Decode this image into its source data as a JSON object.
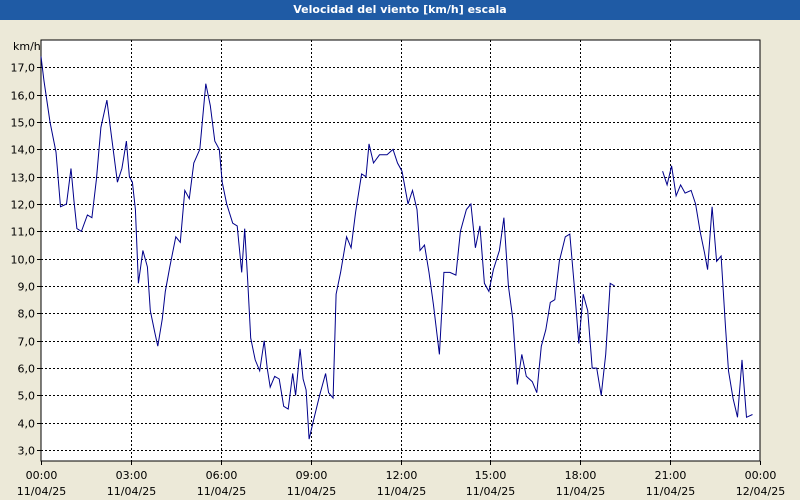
{
  "window": {
    "title": "Velocidad del viento [km/h] escala"
  },
  "chart_data": {
    "type": "line",
    "title": "Velocidad del viento [km/h] escala",
    "ylabel": "km/h",
    "ylim": [
      2.6,
      18.0
    ],
    "yticks": [
      3,
      4,
      5,
      6,
      7,
      8,
      9,
      10,
      11,
      12,
      13,
      14,
      15,
      16,
      17
    ],
    "ytick_labels": [
      "3,0",
      "4,0",
      "5,0",
      "6,0",
      "7,0",
      "8,0",
      "9,0",
      "10,0",
      "11,0",
      "12,0",
      "13,0",
      "14,0",
      "15,0",
      "16,0",
      "17,0"
    ],
    "xlim_hours": [
      0,
      24
    ],
    "xticks": [
      {
        "h": 0,
        "time": "00:00",
        "date": "11/04/25"
      },
      {
        "h": 3,
        "time": "03:00",
        "date": "11/04/25"
      },
      {
        "h": 6,
        "time": "06:00",
        "date": "11/04/25"
      },
      {
        "h": 9,
        "time": "09:00",
        "date": "11/04/25"
      },
      {
        "h": 12,
        "time": "12:00",
        "date": "11/04/25"
      },
      {
        "h": 15,
        "time": "15:00",
        "date": "11/04/25"
      },
      {
        "h": 18,
        "time": "18:00",
        "date": "11/04/25"
      },
      {
        "h": 21,
        "time": "21:00",
        "date": "11/04/25"
      },
      {
        "h": 24,
        "time": "00:00",
        "date": "12/04/25"
      }
    ],
    "grid": true,
    "colors": {
      "line": "#00008B",
      "grid": "#000000",
      "plot_bg": "#FFFFFF",
      "frame_bg": "#ECE9D8"
    },
    "series": [
      {
        "segments": [
          [
            [
              0.0,
              17.4
            ],
            [
              0.1,
              16.5
            ],
            [
              0.3,
              15.0
            ],
            [
              0.5,
              13.9
            ],
            [
              0.65,
              11.9
            ],
            [
              0.85,
              12.0
            ],
            [
              1.0,
              13.3
            ],
            [
              1.1,
              12.1
            ],
            [
              1.2,
              11.1
            ],
            [
              1.35,
              11.0
            ],
            [
              1.55,
              11.6
            ],
            [
              1.7,
              11.5
            ],
            [
              1.85,
              12.9
            ],
            [
              2.0,
              14.8
            ],
            [
              2.2,
              15.8
            ],
            [
              2.35,
              14.5
            ],
            [
              2.55,
              12.8
            ],
            [
              2.7,
              13.3
            ],
            [
              2.85,
              14.3
            ],
            [
              2.95,
              13.0
            ],
            [
              3.05,
              12.8
            ],
            [
              3.15,
              11.8
            ],
            [
              3.25,
              9.1
            ],
            [
              3.4,
              10.3
            ],
            [
              3.55,
              9.7
            ],
            [
              3.65,
              8.1
            ],
            [
              3.8,
              7.3
            ],
            [
              3.9,
              6.8
            ],
            [
              4.05,
              7.8
            ],
            [
              4.15,
              8.8
            ],
            [
              4.3,
              9.7
            ],
            [
              4.5,
              10.8
            ],
            [
              4.65,
              10.6
            ],
            [
              4.8,
              12.5
            ],
            [
              4.95,
              12.2
            ],
            [
              5.1,
              13.5
            ],
            [
              5.3,
              14.0
            ],
            [
              5.5,
              16.4
            ],
            [
              5.65,
              15.6
            ],
            [
              5.8,
              14.3
            ],
            [
              5.95,
              14.0
            ],
            [
              6.05,
              12.8
            ],
            [
              6.2,
              12.0
            ],
            [
              6.4,
              11.3
            ],
            [
              6.55,
              11.2
            ],
            [
              6.7,
              9.5
            ],
            [
              6.8,
              11.1
            ],
            [
              6.9,
              9.2
            ],
            [
              7.0,
              7.1
            ],
            [
              7.15,
              6.3
            ],
            [
              7.3,
              5.9
            ],
            [
              7.45,
              7.0
            ],
            [
              7.55,
              6.0
            ],
            [
              7.65,
              5.3
            ],
            [
              7.8,
              5.7
            ],
            [
              7.95,
              5.6
            ],
            [
              8.1,
              4.6
            ],
            [
              8.25,
              4.5
            ],
            [
              8.4,
              5.8
            ],
            [
              8.5,
              5.0
            ],
            [
              8.65,
              6.7
            ],
            [
              8.75,
              5.6
            ],
            [
              8.85,
              5.2
            ],
            [
              8.95,
              3.4
            ],
            [
              9.1,
              4.1
            ],
            [
              9.3,
              5.0
            ],
            [
              9.5,
              5.8
            ],
            [
              9.6,
              5.1
            ],
            [
              9.75,
              4.9
            ],
            [
              9.85,
              8.7
            ],
            [
              10.0,
              9.5
            ],
            [
              10.2,
              10.8
            ],
            [
              10.35,
              10.4
            ],
            [
              10.5,
              11.7
            ],
            [
              10.7,
              13.1
            ],
            [
              10.85,
              13.0
            ],
            [
              10.95,
              14.2
            ],
            [
              11.1,
              13.5
            ],
            [
              11.3,
              13.8
            ],
            [
              11.55,
              13.8
            ],
            [
              11.75,
              14.0
            ],
            [
              11.9,
              13.5
            ],
            [
              12.05,
              13.2
            ],
            [
              12.25,
              12.0
            ],
            [
              12.4,
              12.5
            ],
            [
              12.55,
              11.8
            ],
            [
              12.65,
              10.3
            ],
            [
              12.8,
              10.5
            ],
            [
              12.95,
              9.5
            ],
            [
              13.1,
              8.3
            ],
            [
              13.3,
              6.5
            ],
            [
              13.45,
              9.5
            ],
            [
              13.65,
              9.5
            ],
            [
              13.85,
              9.4
            ],
            [
              14.0,
              11.0
            ],
            [
              14.2,
              11.8
            ],
            [
              14.35,
              12.0
            ],
            [
              14.5,
              10.4
            ],
            [
              14.65,
              11.2
            ],
            [
              14.8,
              9.1
            ],
            [
              14.95,
              8.8
            ],
            [
              15.1,
              9.6
            ],
            [
              15.3,
              10.3
            ],
            [
              15.45,
              11.5
            ],
            [
              15.6,
              9.0
            ],
            [
              15.75,
              7.8
            ],
            [
              15.9,
              5.4
            ],
            [
              16.05,
              6.5
            ],
            [
              16.2,
              5.7
            ],
            [
              16.4,
              5.5
            ],
            [
              16.55,
              5.1
            ],
            [
              16.7,
              6.8
            ],
            [
              16.85,
              7.4
            ],
            [
              17.0,
              8.4
            ],
            [
              17.15,
              8.5
            ],
            [
              17.3,
              9.9
            ],
            [
              17.5,
              10.8
            ],
            [
              17.65,
              10.9
            ],
            [
              17.8,
              9.0
            ],
            [
              17.95,
              6.9
            ],
            [
              18.1,
              8.7
            ],
            [
              18.25,
              8.1
            ],
            [
              18.4,
              6.0
            ],
            [
              18.55,
              6.0
            ],
            [
              18.7,
              5.0
            ],
            [
              18.85,
              6.5
            ],
            [
              19.0,
              9.1
            ],
            [
              19.15,
              9.0
            ]
          ],
          [
            [
              20.75,
              13.2
            ],
            [
              20.9,
              12.7
            ],
            [
              21.05,
              13.4
            ],
            [
              21.2,
              12.3
            ],
            [
              21.35,
              12.7
            ],
            [
              21.5,
              12.4
            ],
            [
              21.7,
              12.5
            ],
            [
              21.85,
              12.0
            ],
            [
              22.0,
              11.0
            ],
            [
              22.15,
              10.2
            ],
            [
              22.25,
              9.6
            ],
            [
              22.4,
              11.9
            ],
            [
              22.55,
              9.9
            ],
            [
              22.7,
              10.1
            ],
            [
              22.85,
              7.5
            ],
            [
              22.95,
              5.9
            ],
            [
              23.1,
              4.9
            ],
            [
              23.25,
              4.2
            ],
            [
              23.4,
              6.3
            ],
            [
              23.55,
              4.2
            ],
            [
              23.75,
              4.3
            ]
          ]
        ]
      }
    ]
  }
}
